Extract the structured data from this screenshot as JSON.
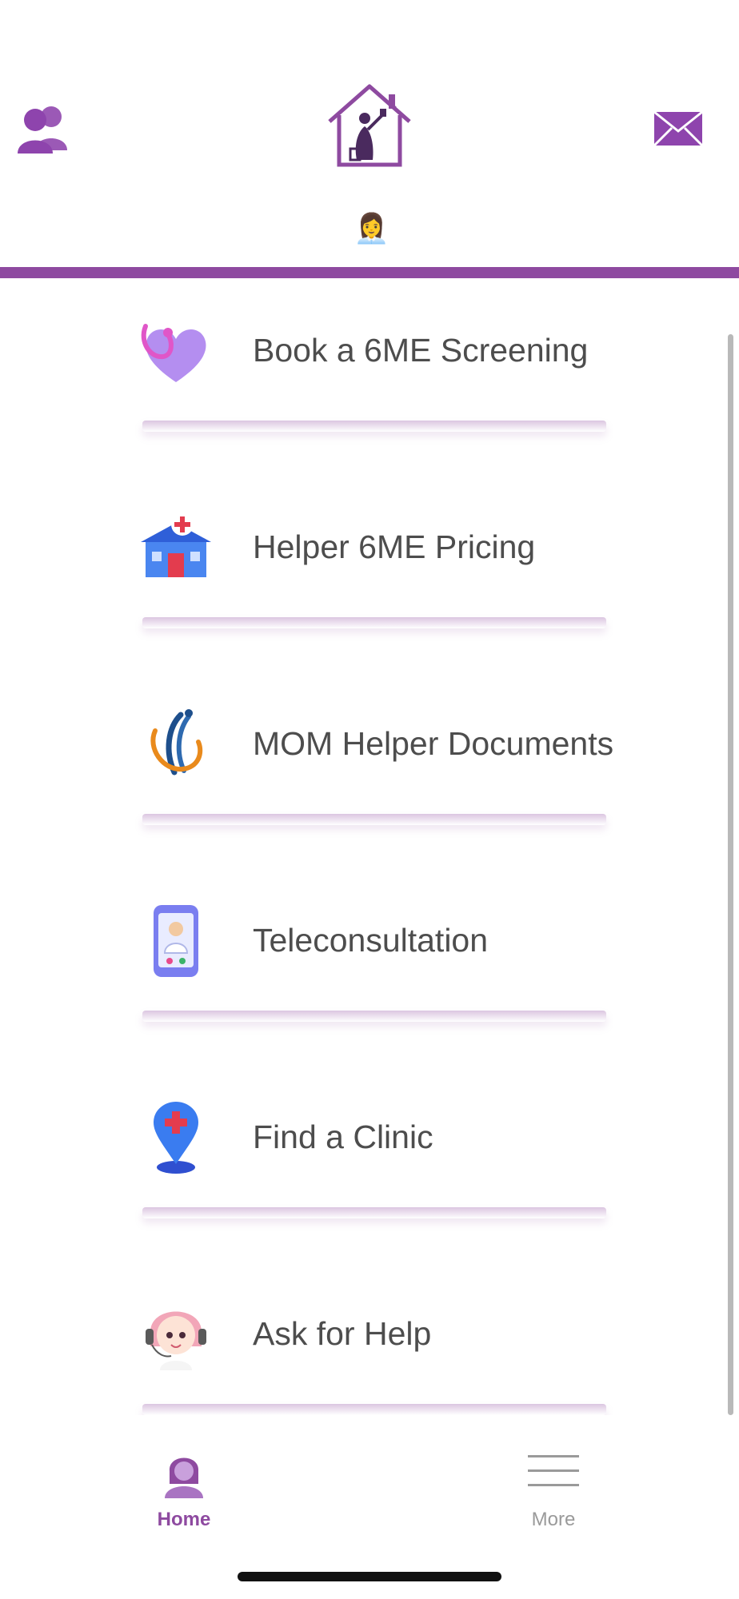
{
  "header": {
    "contacts_icon": "people-icon",
    "logo_icon": "house-helper-logo",
    "mail_icon": "envelope-icon",
    "emoji": "👩‍💼",
    "accent_color": "#8e4aa0"
  },
  "menu": {
    "items": [
      {
        "label": "Book a 6ME Screening",
        "icon": "stethoscope-heart-icon"
      },
      {
        "label": "Helper 6ME Pricing",
        "icon": "hospital-building-icon"
      },
      {
        "label": "MOM Helper Documents",
        "icon": "mom-logo-icon"
      },
      {
        "label": "Teleconsultation",
        "icon": "phone-doctor-icon"
      },
      {
        "label": "Find a Clinic",
        "icon": "map-pin-clinic-icon"
      },
      {
        "label": "Ask for Help",
        "icon": "support-agent-icon"
      }
    ]
  },
  "tabbar": {
    "home": {
      "label": "Home",
      "icon": "woman-avatar-icon",
      "active": true
    },
    "more": {
      "label": "More",
      "icon": "hamburger-menu-icon",
      "active": false
    }
  }
}
